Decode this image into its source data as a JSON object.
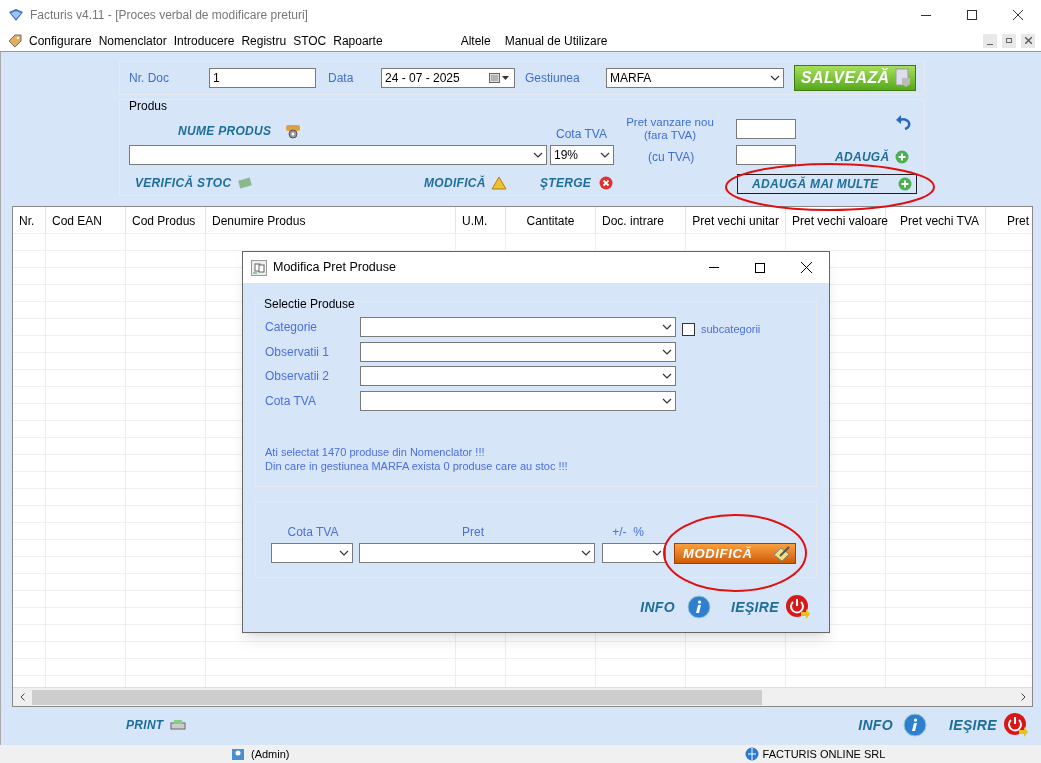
{
  "window": {
    "title": "Facturis v4.11 - [Proces verbal de modificare preturi]"
  },
  "menu": {
    "left": [
      "Configurare",
      "Nomenclator",
      "Introducere",
      "Registru",
      "STOC",
      "Rapoarte"
    ],
    "right": [
      "Altele",
      "Manual de Utilizare"
    ]
  },
  "header": {
    "nr_doc": {
      "label": "Nr. Doc",
      "value": "1"
    },
    "data": {
      "label": "Data",
      "value": "24 - 07 - 2025"
    },
    "gestiunea": {
      "label": "Gestiunea",
      "value": "MARFA"
    },
    "save_button": "SALVEAZĂ"
  },
  "produs": {
    "title": "Produs",
    "name_label": "NUME PRODUS",
    "cota_label": "Cota TVA",
    "cota_value": "19%",
    "pret_label": [
      "Pret vanzare nou",
      "(fara TVA)"
    ],
    "cu_tva_label": "(cu TVA)",
    "adauga": "ADAUGĂ",
    "adauga_multe": "ADAUGĂ MAI MULTE",
    "verifica": "VERIFICĂ STOC",
    "modifica": "MODIFICĂ",
    "sterge": "ŞTERGE"
  },
  "table": {
    "columns": [
      "Nr.",
      "Cod EAN",
      "Cod Produs",
      "Denumire Produs",
      "U.M.",
      "Cantitate",
      "Doc. intrare",
      "Pret vechi unitar",
      "Pret vechi valoare",
      "Pret vechi TVA",
      "Pret"
    ]
  },
  "dialog": {
    "title": "Modifica Pret Produse",
    "group_title": "Selectie Produse",
    "fields": [
      "Categorie",
      "Observatii 1",
      "Observatii 2",
      "Cota TVA"
    ],
    "subcategorii": {
      "label": "subcategorii",
      "checked": false
    },
    "messages": [
      "Ati selectat 1470 produse din Nomenclator !!!",
      "Din care in gestiunea MARFA exista 0 produse care au stoc !!!"
    ],
    "lower_labels": [
      "Cota TVA",
      "Pret",
      "+/-  %"
    ],
    "modifica": "MODIFICĂ",
    "info": "INFO",
    "iesire": "IEŞIRE"
  },
  "footer": {
    "print": "PRINT",
    "info": "INFO",
    "iesire": "IEŞIRE"
  },
  "status_bar": {
    "user": "(Admin)",
    "company": "FACTURIS ONLINE SRL"
  }
}
